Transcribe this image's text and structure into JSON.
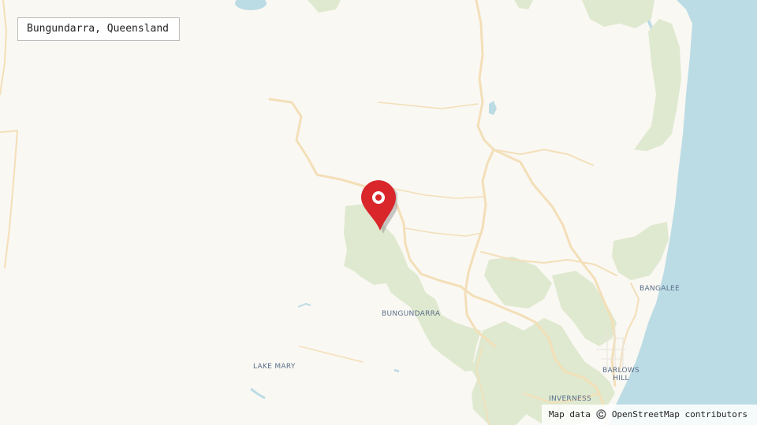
{
  "search": {
    "value": "Bungundarra, Queensland"
  },
  "places": {
    "bungundarra": "BUNGUNDARRA",
    "lake_mary": "LAKE MARY",
    "bangalee": "BANGALEE",
    "barlows_hill": "BARLOWS\nHILL",
    "inverness": "INVERNESS"
  },
  "attribution": "Map data ©️ OpenStreetMap contributors",
  "marker": {
    "icon": "map-pin-icon",
    "color": "#d9262b"
  },
  "colors": {
    "land": "#faf8f3",
    "sea": "#bcdce5",
    "forest": "#dfe9cf",
    "road": "#f3dfb8"
  }
}
